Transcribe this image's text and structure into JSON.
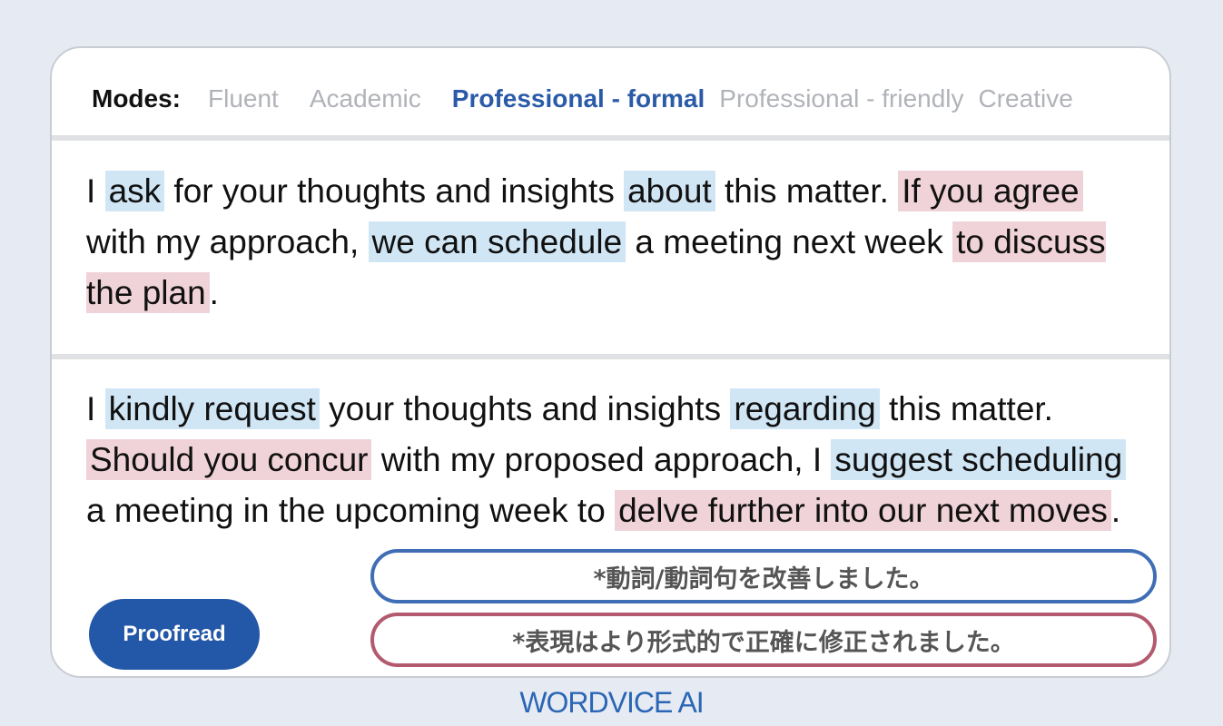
{
  "modes": {
    "label": "Modes:",
    "items": [
      "Fluent",
      "Academic",
      "Professional - formal",
      "Professional - friendly",
      "Creative"
    ],
    "active": "Professional - formal"
  },
  "original": [
    {
      "text": "I "
    },
    {
      "text": "ask",
      "hl": "blue"
    },
    {
      "text": " for your thoughts and insights "
    },
    {
      "text": "about",
      "hl": "blue"
    },
    {
      "text": " this matter. "
    },
    {
      "text": "If you agree",
      "hl": "pink"
    },
    {
      "text": " with my approach, "
    },
    {
      "text": "we can schedule",
      "hl": "blue"
    },
    {
      "text": " a meeting next week "
    },
    {
      "text": "to discuss the plan",
      "hl": "pink"
    },
    {
      "text": "."
    }
  ],
  "revised": [
    {
      "text": "I "
    },
    {
      "text": "kindly request",
      "hl": "blue"
    },
    {
      "text": " your thoughts and insights "
    },
    {
      "text": "regarding",
      "hl": "blue"
    },
    {
      "text": " this matter. "
    },
    {
      "text": "Should you concur",
      "hl": "pink"
    },
    {
      "text": " with my proposed approach, I "
    },
    {
      "text": "suggest scheduling",
      "hl": "blue"
    },
    {
      "text": " a meeting in the upcoming week to "
    },
    {
      "text": "delve further into our next moves",
      "hl": "pink"
    },
    {
      "text": "."
    }
  ],
  "proofread_label": "Proofread",
  "notes": {
    "verb": "*動詞/動詞句を改善しました。",
    "formal": "*表現はより形式的で正確に修正されました。"
  },
  "brand": "WORDVICE AI",
  "colors": {
    "accent": "#2b5ba8",
    "highlight_blue": "#d1e6f5",
    "highlight_pink": "#f0d3d9",
    "note_blue": "#3f6eb5",
    "note_pink": "#b35a6e"
  }
}
